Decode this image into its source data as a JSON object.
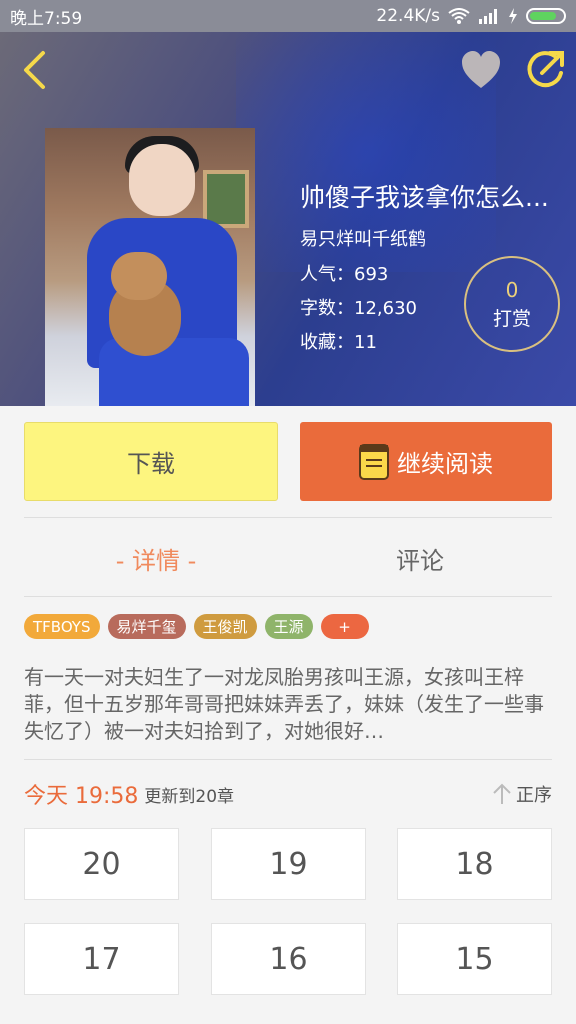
{
  "status_bar": {
    "time": "晚上7:59",
    "network_speed": "22.4K/s"
  },
  "book": {
    "title": "帅傻子我该拿你怎么...",
    "author": "易只烊叫千纸鹤",
    "popularity_label": "人气：693",
    "word_count_label": "字数：12,630",
    "favorites_label": "收藏：11",
    "tip_count": "0",
    "tip_label": "打赏"
  },
  "actions": {
    "download": "下载",
    "continue_reading": "继续阅读"
  },
  "tabs": {
    "detail": "- 详情 -",
    "comments": "评论"
  },
  "tags": [
    "TFBOYS",
    "易烊千玺",
    "王俊凯",
    "王源",
    "+"
  ],
  "synopsis": "有一天一对夫妇生了一对龙凤胎男孩叫王源，女孩叫王梓菲，但十五岁那年哥哥把妹妹弄丢了，妹妹（发生了一些事失忆了）被一对夫妇拾到了，对她很好…",
  "update": {
    "time": "今天 19:58",
    "text": "更新到20章",
    "sort_label": "正序"
  },
  "chapters": [
    "20",
    "19",
    "18",
    "17",
    "16",
    "15"
  ],
  "colors": {
    "accent_orange": "#ea6b3b",
    "download_yellow": "#fdf57f",
    "icon_yellow": "#f5d94a"
  },
  "icons": [
    "back-icon",
    "heart-icon",
    "share-icon",
    "book-icon",
    "sort-arrow-icon",
    "wifi-icon",
    "signal-icon",
    "battery-icon"
  ]
}
